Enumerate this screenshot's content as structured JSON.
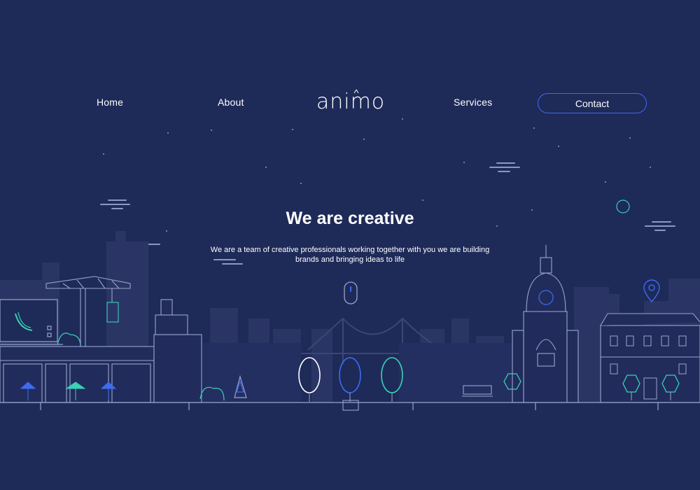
{
  "nav": {
    "home": "Home",
    "about": "About",
    "services": "Services",
    "contact": "Contact"
  },
  "brand": {
    "logo_text": "animo"
  },
  "hero": {
    "title": "We are creative",
    "subtitle": "We are a team of creative professionals working together with you we are building brands and bringing ideas to life"
  },
  "icons": {
    "scroll": "mouse-scroll-icon",
    "location": "location-pin-icon",
    "banana": "banana-icon"
  },
  "colors": {
    "background": "#1e2a58",
    "accent_blue": "#3d6cf0",
    "accent_teal": "#3ad1b5",
    "line": "#9aa4cc",
    "text": "#ffffff"
  }
}
